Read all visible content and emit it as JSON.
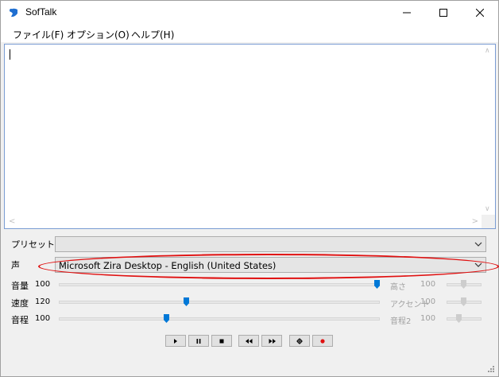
{
  "window": {
    "title": "SofTalk"
  },
  "menu": {
    "file": "ファイル(F)",
    "option": "オプション(O)",
    "help": "ヘルプ(H)"
  },
  "editor": {
    "text": ""
  },
  "preset": {
    "label": "プリセット",
    "value": ""
  },
  "voice": {
    "label": "声",
    "value": "Microsoft Zira Desktop - English (United States)"
  },
  "sliders": {
    "volume": {
      "label": "音量",
      "value": "100",
      "level": 1.0
    },
    "speed": {
      "label": "速度",
      "value": "120",
      "level": 0.4
    },
    "pitch": {
      "label": "音程",
      "value": "100",
      "level": 0.33
    },
    "height": {
      "label": "高さ",
      "value": "100",
      "level": 0.5
    },
    "accent": {
      "label": "アクセント",
      "value": "100",
      "level": 0.5
    },
    "pitch2": {
      "label": "音程2",
      "value": "100",
      "level": 0.33
    }
  },
  "colors": {
    "accent": "#0078d7",
    "annotation": "#e01010"
  },
  "transport": [
    "play-icon",
    "pause-icon",
    "stop-icon",
    "rewind-icon",
    "fast-forward-icon",
    "settings-icon",
    "record-icon"
  ]
}
